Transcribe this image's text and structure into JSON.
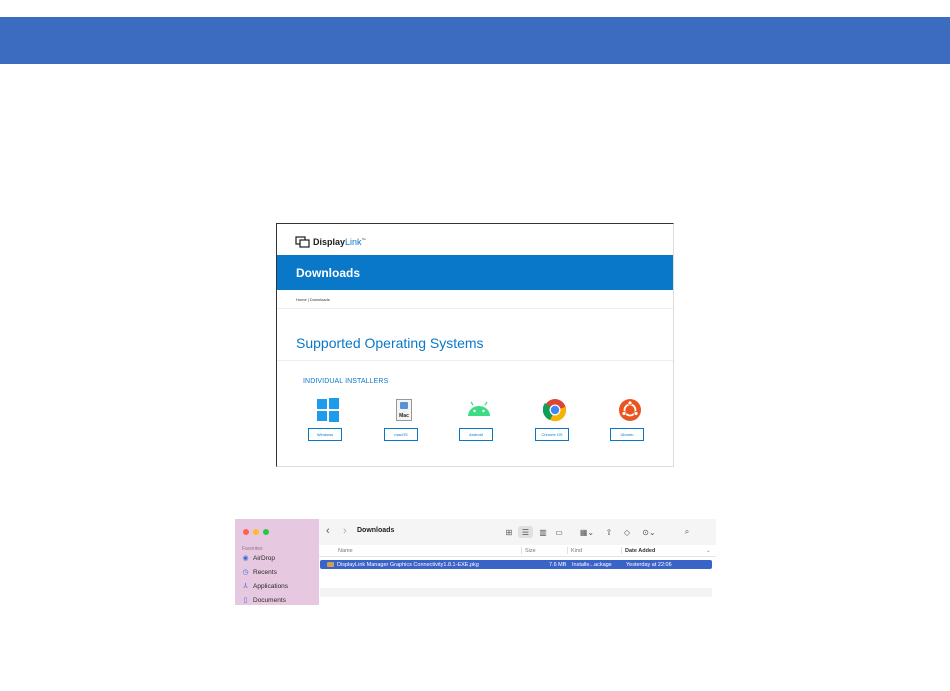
{
  "website": {
    "logo_display": "Display",
    "logo_link": "Link",
    "logo_tm": "™",
    "banner_title": "Downloads",
    "breadcrumb": "Home | Downloads",
    "heading": "Supported Operating Systems",
    "subheading": "INDIVIDUAL INSTALLERS",
    "mac_icon_label": "Mac",
    "installers": [
      {
        "label": "Windows",
        "icon": "windows-icon"
      },
      {
        "label": "macOS",
        "icon": "mac-icon"
      },
      {
        "label": "Android",
        "icon": "android-icon"
      },
      {
        "label": "Chrome OS",
        "icon": "chrome-icon"
      },
      {
        "label": "Ubuntu",
        "icon": "ubuntu-icon"
      }
    ],
    "colors": {
      "brand_blue": "#0a78c8",
      "windows": "#1e9bea",
      "android": "#3ddc84",
      "ubuntu": "#e95420"
    }
  },
  "finder": {
    "title": "Downloads",
    "favorites_label": "Favorites",
    "sidebar_items": [
      {
        "label": "AirDrop",
        "icon": "airdrop-icon"
      },
      {
        "label": "Recents",
        "icon": "clock-icon"
      },
      {
        "label": "Applications",
        "icon": "applications-icon"
      },
      {
        "label": "Documents",
        "icon": "document-icon"
      }
    ],
    "columns": {
      "name": "Name",
      "size": "Size",
      "kind": "Kind",
      "date_added": "Date Added"
    },
    "files": [
      {
        "name": "DisplayLink Manager Graphics Connectivity1.8.1-EXE.pkg",
        "size": "7.6 MB",
        "kind": "Installe...ackage",
        "date_added": "Yesterday at 22:06"
      }
    ],
    "colors": {
      "selection": "#3a63c8",
      "sidebar": "#e6c8e0"
    }
  },
  "top_bar": {
    "color": "#3c6cc0"
  }
}
